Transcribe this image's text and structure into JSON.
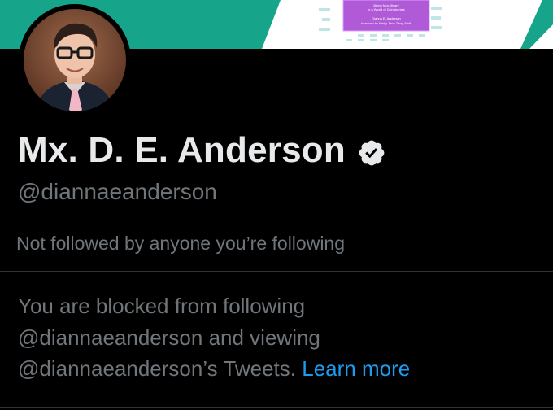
{
  "profile": {
    "display_name": "Mx. D. E. Anderson",
    "handle": "@diannaeanderson",
    "verified_icon": "verified-badge-icon",
    "followed_status": "Not followed by anyone you’re following"
  },
  "banner": {
    "book_cover": {
      "line1": "Being Non-Binary",
      "line2": "in a World of Dichotomies",
      "author": "Dianna E. Anderson",
      "foreword": "foreword by Emily Jane Zeng-Swift"
    }
  },
  "blocked": {
    "line1": "You are blocked from following",
    "line2": "@diannaeanderson and viewing",
    "line3": "@diannaeanderson’s Tweets.",
    "learn_more": "Learn more"
  },
  "colors": {
    "background": "#000000",
    "primary_text": "#e7e9ea",
    "secondary_text": "#71767b",
    "link": "#1d9bf0",
    "banner_teal": "#16a48b"
  }
}
